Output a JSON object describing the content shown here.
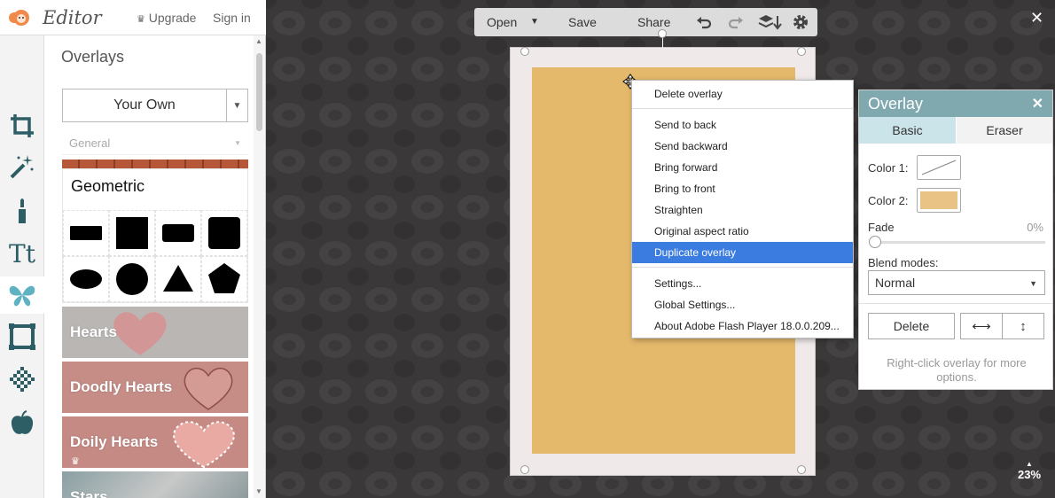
{
  "header": {
    "brand": "Editor",
    "upgrade_label": "Upgrade",
    "signin_label": "Sign in",
    "crown_icon": "crown-icon"
  },
  "tools": [
    {
      "name": "crop",
      "icon": "crop-icon"
    },
    {
      "name": "effects",
      "icon": "magic-wand-icon"
    },
    {
      "name": "touch-up",
      "icon": "brush-icon"
    },
    {
      "name": "text",
      "icon": "text-icon",
      "text": "Tt"
    },
    {
      "name": "overlays",
      "icon": "butterfly-icon",
      "active": true
    },
    {
      "name": "frames",
      "icon": "frame-icon"
    },
    {
      "name": "textures",
      "icon": "texture-icon"
    },
    {
      "name": "seasonal",
      "icon": "apple-icon"
    }
  ],
  "panel": {
    "title": "Overlays",
    "your_own_label": "Your Own",
    "category_filter": "General",
    "geometric_title": "Geometric",
    "categories": [
      {
        "label": "Hearts",
        "color": "#b9b6b4",
        "premium": false
      },
      {
        "label": "Doodly Hearts",
        "color": "#c58d86",
        "premium": false
      },
      {
        "label": "Doily Hearts",
        "color": "#c58a84",
        "premium": true
      },
      {
        "label": "Stars",
        "color": "#8aa0a3",
        "premium": false
      }
    ]
  },
  "toolbar": {
    "open_label": "Open",
    "save_label": "Save",
    "share_label": "Share"
  },
  "canvas": {
    "zoom": "23%",
    "doc_color": "#e4b96b"
  },
  "context_menu": {
    "items": [
      {
        "label": "Delete overlay"
      },
      {
        "label": "Send to back"
      },
      {
        "label": "Send backward"
      },
      {
        "label": "Bring forward"
      },
      {
        "label": "Bring to front"
      },
      {
        "label": "Straighten"
      },
      {
        "label": "Original aspect ratio"
      },
      {
        "label": "Duplicate overlay",
        "highlighted": true
      },
      {
        "label": "Settings..."
      },
      {
        "label": "Global Settings..."
      },
      {
        "label": "About Adobe Flash Player 18.0.0.209..."
      }
    ]
  },
  "overlay_panel": {
    "title": "Overlay",
    "tab_basic": "Basic",
    "tab_eraser": "Eraser",
    "color1_label": "Color 1:",
    "color2_label": "Color 2:",
    "color2_value": "#e8c385",
    "fade_label": "Fade",
    "fade_value": "0%",
    "fade_fraction": 0,
    "blend_label": "Blend modes:",
    "blend_value": "Normal",
    "delete_label": "Delete",
    "hint": "Right-click overlay for more options."
  }
}
